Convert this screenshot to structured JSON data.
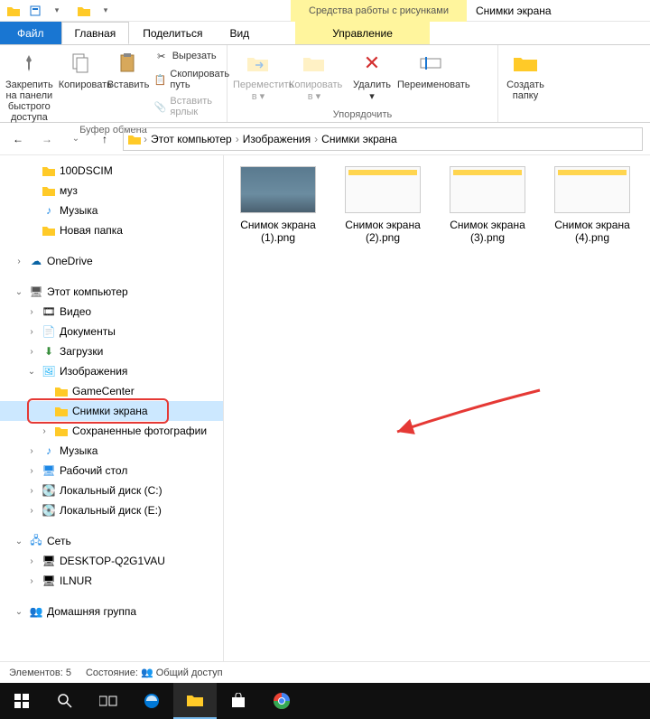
{
  "titlebar": {
    "context_title": "Средства работы с рисунками",
    "window_title": "Снимки экрана"
  },
  "tabs": {
    "file": "Файл",
    "home": "Главная",
    "share": "Поделиться",
    "view": "Вид",
    "manage": "Управление"
  },
  "ribbon": {
    "pin": "Закрепить на панели быстрого доступа",
    "copy": "Копировать",
    "paste": "Вставить",
    "cut": "Вырезать",
    "copy_path": "Скопировать путь",
    "paste_shortcut": "Вставить ярлык",
    "group_clipboard": "Буфер обмена",
    "move_to": "Переместить в",
    "copy_to": "Копировать в",
    "delete": "Удалить",
    "rename": "Переименовать",
    "group_organize": "Упорядочить",
    "new_folder": "Создать папку"
  },
  "breadcrumb": {
    "root": "Этот компьютер",
    "lvl1": "Изображения",
    "lvl2": "Снимки экрана"
  },
  "tree": {
    "n100dcim": "100DSCIM",
    "muz": "муз",
    "music": "Музыка",
    "newfolder": "Новая папка",
    "onedrive": "OneDrive",
    "thispc": "Этот компьютер",
    "video": "Видео",
    "documents": "Документы",
    "downloads": "Загрузки",
    "pictures": "Изображения",
    "gamecenter": "GameCenter",
    "screenshots": "Снимки экрана",
    "savedphotos": "Сохраненные фотографии",
    "music2": "Музыка",
    "desktop": "Рабочий стол",
    "diskc": "Локальный диск (C:)",
    "diske": "Локальный диск (E:)",
    "network": "Сеть",
    "desktop_q": "DESKTOP-Q2G1VAU",
    "ilnur": "ILNUR",
    "homegroup": "Домашняя группа"
  },
  "items": [
    {
      "name": "Снимок экрана (1).png"
    },
    {
      "name": "Снимок экрана (2).png"
    },
    {
      "name": "Снимок экрана (3).png"
    },
    {
      "name": "Снимок экрана (4).png"
    }
  ],
  "status": {
    "count_label": "Элементов:",
    "count": "5",
    "state_label": "Состояние:",
    "state": "Общий доступ"
  }
}
